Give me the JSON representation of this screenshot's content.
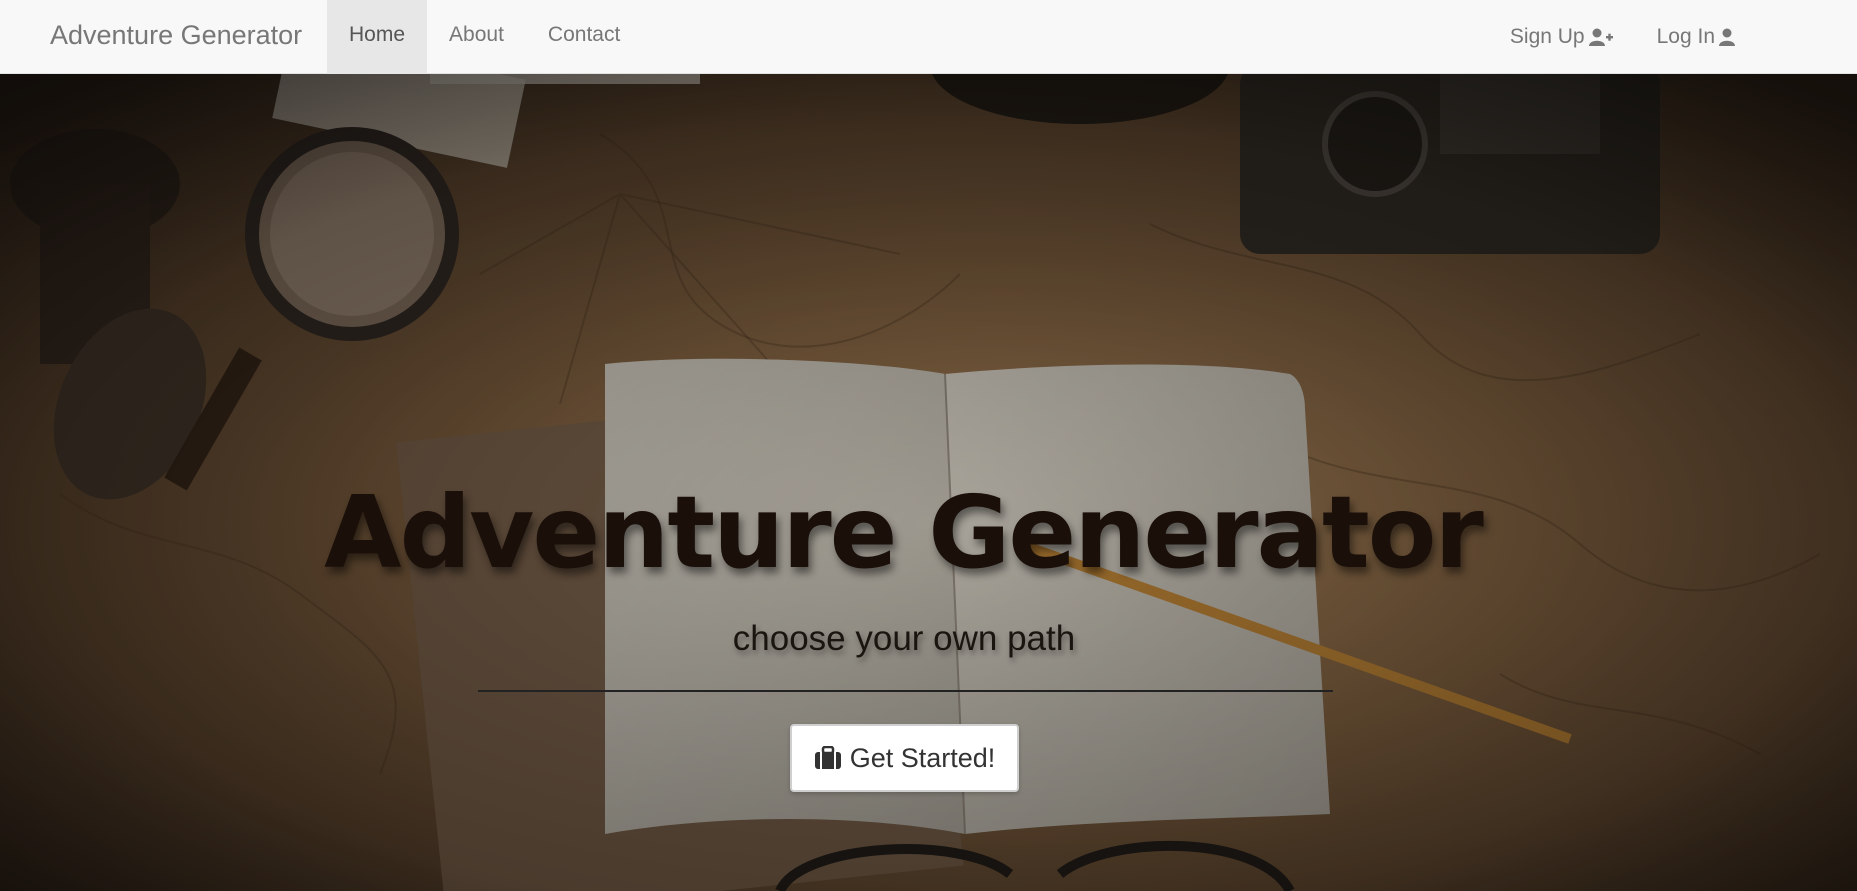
{
  "nav": {
    "brand": "Adventure Generator",
    "links": [
      {
        "label": "Home",
        "active": true
      },
      {
        "label": "About",
        "active": false
      },
      {
        "label": "Contact",
        "active": false
      }
    ],
    "signup_label": "Sign Up",
    "signup_icon": "user-plus-icon",
    "login_label": "Log In",
    "login_icon": "user-icon"
  },
  "hero": {
    "title": "Adventure Generator",
    "subtitle": "choose your own path",
    "cta_label": "Get Started!",
    "cta_icon": "briefcase-icon",
    "background": "vintage map desk with notebook, pencil, magnifying glass and camera"
  },
  "colors": {
    "navbar_bg": "#f8f8f8",
    "nav_text": "#777777",
    "active_tab_bg": "#e7e7e7",
    "title_color": "#1b0f0a"
  }
}
